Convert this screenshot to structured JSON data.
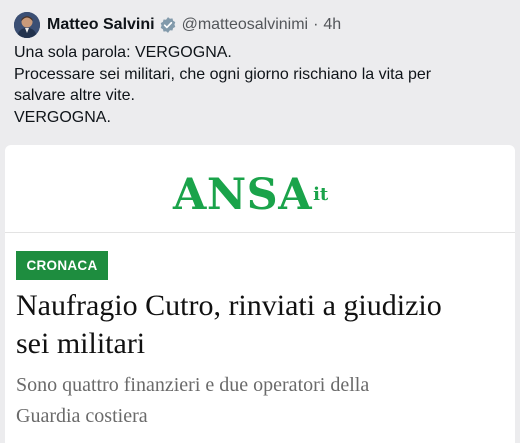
{
  "tweet": {
    "author_name": "Matteo Salvini",
    "handle": "@matteosalvinimi",
    "separator": "·",
    "time": "4h",
    "text_lines": [
      "Una sola parola: VERGOGNA.",
      "Processare sei militari, che ogni giorno rischiano la vita per",
      "salvare altre vite.",
      "VERGOGNA."
    ],
    "avatar_icon": "avatar-photo",
    "verified_icon": "verified-badge-icon",
    "verified_color": "#829aab"
  },
  "card": {
    "logo": {
      "word": "ANSA",
      "suffix": "it",
      "color": "#1aa34a"
    },
    "category": {
      "label": "CRONACA",
      "color": "#1e8d3f"
    },
    "headline_lines": [
      "Naufragio Cutro, rinviati a giudizio",
      "sei militari"
    ],
    "subtitle_lines": [
      "Sono quattro finanzieri e due operatori della",
      "Guardia costiera"
    ]
  }
}
